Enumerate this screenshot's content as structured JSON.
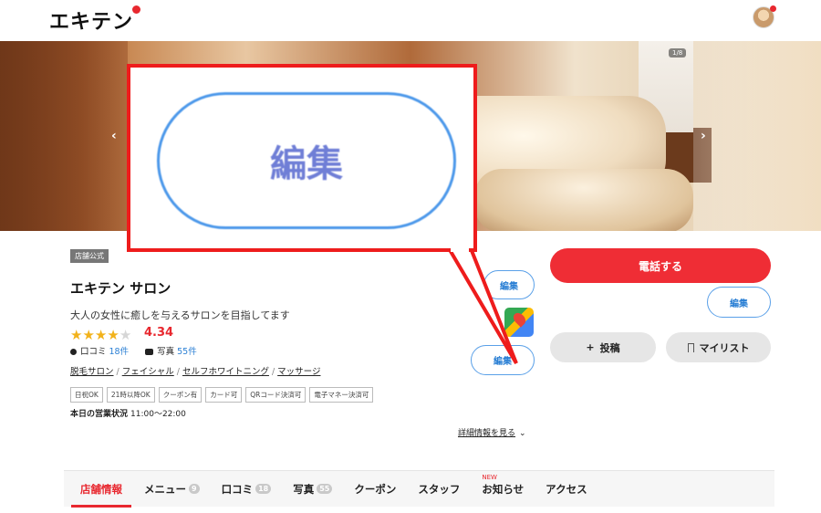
{
  "header": {
    "logo_text": "エキテン",
    "avatar_icon": "user-avatar-icon"
  },
  "hero": {
    "prev_icon": "‹",
    "next_icon": "›",
    "counter": "1/8"
  },
  "shop": {
    "official_badge": "店舗公式",
    "name": "エキテン サロン",
    "catchphrase": "大人の女性に癒しを与えるサロンを目指してます",
    "rating": "4.34",
    "stars_filled": 4,
    "reviews_label": "口コミ",
    "reviews_count": "18件",
    "photos_label": "写真",
    "photos_count": "55件",
    "genres": [
      "脱毛サロン",
      "フェイシャル",
      "セルフホワイトニング",
      "マッサージ"
    ],
    "tags": [
      "日祝OK",
      "21時以降OK",
      "クーポン有",
      "カード可",
      "QRコード決済可",
      "電子マネー決済可"
    ],
    "hours_label": "本日の営業状況",
    "hours_value": "11:00〜22:00",
    "detail_link": "詳細情報を見る"
  },
  "edit_buttons": {
    "label": "編集",
    "callout_label": "編集"
  },
  "actions": {
    "call": "電話する",
    "post": "投稿",
    "mylist": "マイリスト"
  },
  "tabs": [
    {
      "label": "店舗情報",
      "badge": "",
      "active": true,
      "new": ""
    },
    {
      "label": "メニュー",
      "badge": "9",
      "active": false,
      "new": ""
    },
    {
      "label": "口コミ",
      "badge": "18",
      "active": false,
      "new": ""
    },
    {
      "label": "写真",
      "badge": "55",
      "active": false,
      "new": ""
    },
    {
      "label": "クーポン",
      "badge": "",
      "active": false,
      "new": ""
    },
    {
      "label": "スタッフ",
      "badge": "",
      "active": false,
      "new": ""
    },
    {
      "label": "お知らせ",
      "badge": "",
      "active": false,
      "new": "NEW"
    },
    {
      "label": "アクセス",
      "badge": "",
      "active": false,
      "new": ""
    }
  ],
  "colors": {
    "brand_red": "#ef2d35",
    "link_blue": "#2a7fd4",
    "callout_red": "#ee1c1c",
    "star_gold": "#f2b21b"
  }
}
